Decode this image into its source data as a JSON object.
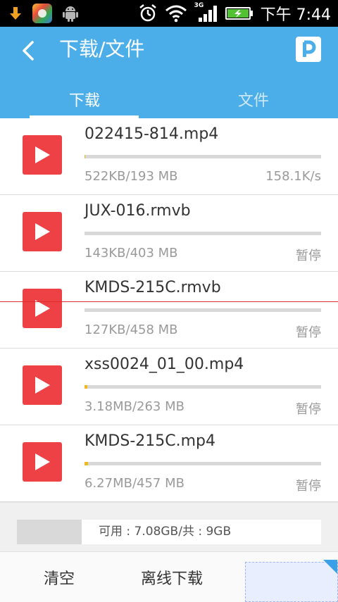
{
  "status_bar": {
    "time": "下午 7:44",
    "network_label": "3G",
    "icons": [
      "download-notification-icon",
      "app-icon",
      "android-icon",
      "alarm-icon",
      "wifi-icon",
      "signal-icon",
      "battery-charging-icon"
    ]
  },
  "header": {
    "title": "下载/文件",
    "back_icon": "back-arrow-icon",
    "badge_icon": "p-logo-icon",
    "background_color": "#4baee9"
  },
  "tabs": [
    {
      "label": "下载",
      "active": true
    },
    {
      "label": "文件",
      "active": false
    }
  ],
  "downloads": [
    {
      "name": "022415-814.mp4",
      "size": "522KB/193 MB",
      "status": "158.1K/s",
      "progress": 0.003
    },
    {
      "name": "JUX-016.rmvb",
      "size": "143KB/403 MB",
      "status": "暂停",
      "progress": 0.0004
    },
    {
      "name": "KMDS-215C.rmvb",
      "size": "127KB/458 MB",
      "status": "暂停",
      "progress": 0.0003
    },
    {
      "name": "xss0024_01_00.mp4",
      "size": "3.18MB/263 MB",
      "status": "暂停",
      "progress": 0.012
    },
    {
      "name": "KMDS-215C.mp4",
      "size": "6.27MB/457 MB",
      "status": "暂停",
      "progress": 0.014
    }
  ],
  "storage": {
    "text": "可用 : 7.08GB/共 : 9GB"
  },
  "bottom_bar": {
    "clear_label": "清空",
    "offline_label": "离线下载"
  },
  "colors": {
    "accent": "#4baee9",
    "play_button": "#ed4146",
    "progress": "#f0b81a"
  }
}
